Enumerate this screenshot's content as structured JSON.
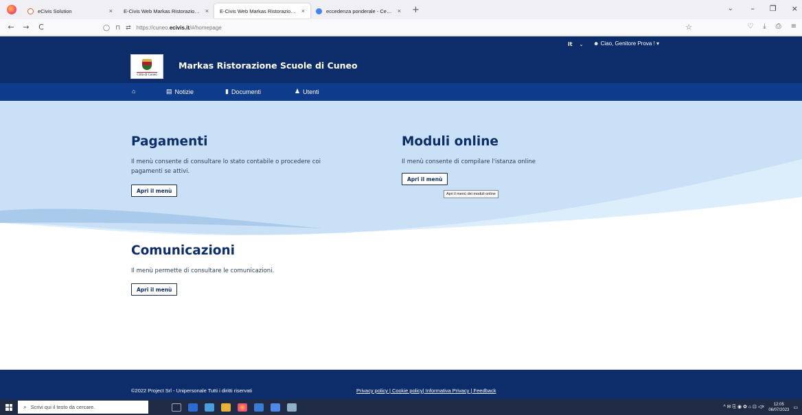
{
  "browser": {
    "tabs": [
      {
        "title": "eCivis Solution",
        "icon_color": "#e55a2b",
        "active": false
      },
      {
        "title": "E-Civis Web Markas Ristorazione Sc",
        "icon_color": "",
        "active": false
      },
      {
        "title": "E-Civis Web Markas Ristorazione Sc",
        "icon_color": "",
        "active": true
      },
      {
        "title": "eccedenza ponderale - Cerca cu",
        "icon_color": "#4285f4",
        "active": false
      }
    ],
    "tab_close": "×",
    "new_tab": "+",
    "url_prefix": "https://cuneo.",
    "url_domain": "ecivis.it",
    "url_suffix": "/#/homepage",
    "back": "←",
    "forward": "→",
    "reload": "C",
    "tabs_dropdown": "⌄",
    "win_minimize": "–",
    "win_restore": "❐",
    "win_close": "×",
    "bookmark_star": "☆",
    "pocket": "♡",
    "download": "⤓",
    "extensions": "⎙",
    "menu": "≡"
  },
  "header": {
    "language": "it",
    "language_chevron": "⌄",
    "user_greeting": "Ciao, Genitore Prova !",
    "user_icon": "☻",
    "user_chevron": "▾",
    "logo_text": "Città di Cuneo",
    "site_title": "Markas Ristorazione Scuole di Cuneo",
    "menu": [
      {
        "label": "",
        "icon": "home-icon",
        "glyph": "⌂"
      },
      {
        "label": "Notizie",
        "icon": "newspaper-icon",
        "glyph": "▤"
      },
      {
        "label": "Documenti",
        "icon": "document-icon",
        "glyph": "▮"
      },
      {
        "label": "Utenti",
        "icon": "users-icon",
        "glyph": "♟"
      }
    ]
  },
  "sections": {
    "pagamenti": {
      "title": "Pagamenti",
      "desc_line1": "Il menù consente di consultare lo stato contabile o procedere coi",
      "desc_line2": "pagamenti se attivi.",
      "button": "Apri il menù"
    },
    "moduli": {
      "title": "Moduli online",
      "desc": "Il menù consente di compilare l'istanza online",
      "button": "Apri il menù",
      "tooltip": "Apri il menù dei moduli online"
    },
    "comunicazioni": {
      "title": "Comunicazioni",
      "desc": "Il menù permette di consultare le comunicazioni.",
      "button": "Apri il menù"
    }
  },
  "footer": {
    "copyright": "©2022 Project Srl - Unipersonale Tutti i diritti riservati",
    "links": [
      "Privacy policy ",
      " Cookie policy",
      " Informativa Privacy ",
      " Feedback"
    ],
    "separator": "|"
  },
  "taskbar": {
    "search_placeholder": "Scrivi qui il testo da cercare.",
    "search_icon": "⌕",
    "time": "12:05",
    "date": "06/07/2023",
    "tray_icons": "^ ✉ ⎘ ◉ ✿ ⌂ ⊡ ◁×"
  },
  "colors": {
    "header_bg": "#0c2d69",
    "menubar_bg": "#0f3c8a",
    "hero_light": "#c7def5",
    "hero_lighter": "#dfeefb",
    "title_color": "#0c2d69"
  }
}
